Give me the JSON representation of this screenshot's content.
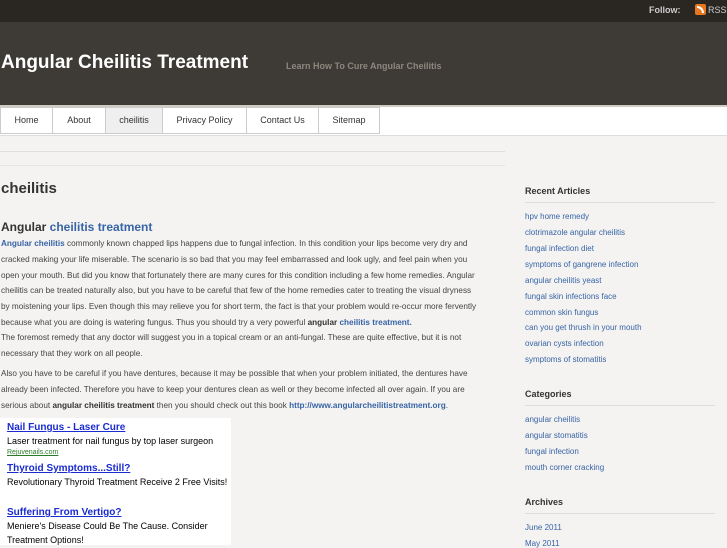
{
  "topbar": {
    "follow_label": "Follow:",
    "rss_label": "RSS"
  },
  "header": {
    "site_title": "Angular Cheilitis Treatment",
    "tagline": "Learn How To Cure Angular Cheilitis"
  },
  "nav": {
    "items": [
      "Home",
      "About",
      "cheilitis",
      "Privacy Policy",
      "Contact Us",
      "Sitemap"
    ]
  },
  "page": {
    "title": "cheilitis"
  },
  "post": {
    "title_prefix": "Angular ",
    "title_link": "cheilitis treatment",
    "p1": {
      "lead_link": "Angular cheilitis",
      "text": " commonly known chapped lips happens due to fungal infection. In this condition your lips become very dry and cracked making your life miserable. The scenario is so bad that you may feel embarrassed and look ugly, and feel pain when you open your mouth. But did you know that fortunately there are many cures for this condition including a few home remedies. Angular cheilitis can be treated naturally also, but you have to be careful that few of the home remedies cater to treating the visual dryness by moistening your lips. Even though this may relieve you for short term, the fact is that your problem would re-occur more fervently because what you are doing is watering fungus. Thus you should try a very powerful ",
      "bold_angular": "angular",
      "end_link": "cheilitis treatment."
    },
    "p2": "The foremost remedy that any doctor will suggest you in a topical cream or an anti-fungal. These are quite effective, but it is not necessary that they work on all people.",
    "p3": {
      "text": "Also you have to be careful if you have dentures, because it may be possible that when your problem initiated, the dentures have already been infected. Therefore you have to keep your dentures clean as well or they become infected all over again. If you are serious about ",
      "bold": "angular cheilitis treatment",
      "mid": " then you should check out this book ",
      "link": "http://www.angularcheilitistreatment.org",
      "end": "."
    }
  },
  "ads": [
    {
      "title": "Nail Fungus - Laser Cure",
      "desc": "Laser treatment for nail fungus by top laser surgeon",
      "url": "Rejuvenails.com"
    },
    {
      "title": "Thyroid Symptoms...Still?",
      "desc": "Revolutionary Thyroid Treatment Receive 2 Free Visits!"
    },
    {
      "title": "Suffering From Vertigo?",
      "desc": "Meniere's Disease Could Be The Cause. Consider Treatment Options!"
    }
  ],
  "sidebar": {
    "recent_heading": "Recent Articles",
    "recent": [
      "hpv home remedy",
      "clotrimazole angular cheilitis",
      "fungal infection diet",
      "symptoms of gangrene infection",
      "angular cheilitis yeast",
      "fungal skin infections face",
      "common skin fungus",
      "can you get thrush in your mouth",
      "ovarian cysts infection",
      "symptoms of stomatitis"
    ],
    "categories_heading": "Categories",
    "categories": [
      "angular cheilitis",
      "angular stomatitis",
      "fungal infection",
      "mouth corner cracking"
    ],
    "archives_heading": "Archives",
    "archives": [
      "June 2011",
      "May 2011"
    ]
  },
  "colors": {
    "header_bg": "#3e3a35",
    "topbar_bg": "#2a2622",
    "link": "#3764a6",
    "ad_link": "#1a2bcf"
  }
}
